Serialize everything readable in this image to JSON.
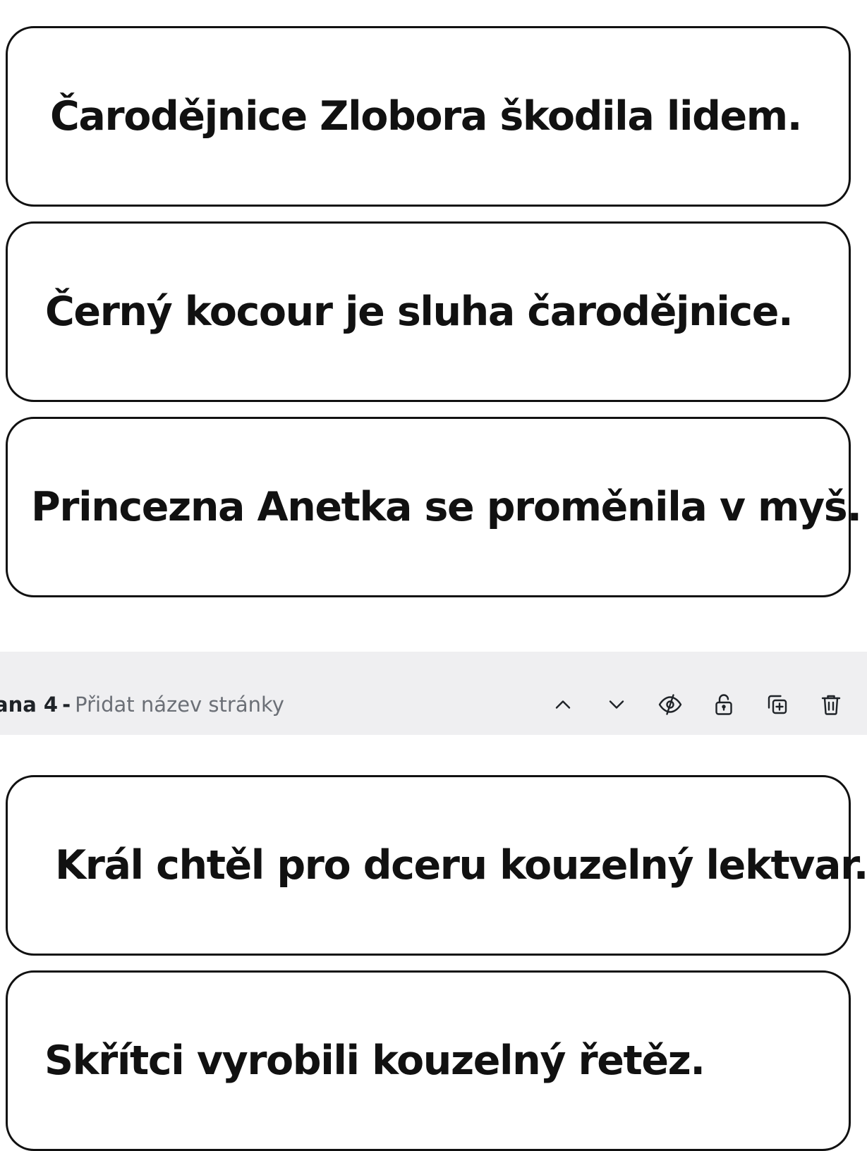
{
  "cards_top": [
    {
      "text": "Čarodějnice Zlobora škodila lidem."
    },
    {
      "text": "Černý kocour je sluha čarodějnice."
    },
    {
      "text": "Princezna Anetka se proměnila v myš."
    }
  ],
  "page_header": {
    "page_number": "ana 4",
    "separator": "-",
    "title_placeholder": "Přidat název stránky",
    "actions": [
      {
        "icon": "chevron-up-icon"
      },
      {
        "icon": "chevron-down-icon"
      },
      {
        "icon": "hide-eye-icon"
      },
      {
        "icon": "unlock-icon"
      },
      {
        "icon": "duplicate-page-icon"
      },
      {
        "icon": "trash-icon"
      }
    ]
  },
  "cards_bottom": [
    {
      "text": "Král chtěl pro dceru kouzelný lektvar."
    },
    {
      "text": "Skřítci vyrobili kouzelný řetěz."
    }
  ],
  "colors": {
    "card_border": "#111111",
    "page_bar_background": "#efeff1",
    "placeholder_text": "#6b6f76"
  }
}
